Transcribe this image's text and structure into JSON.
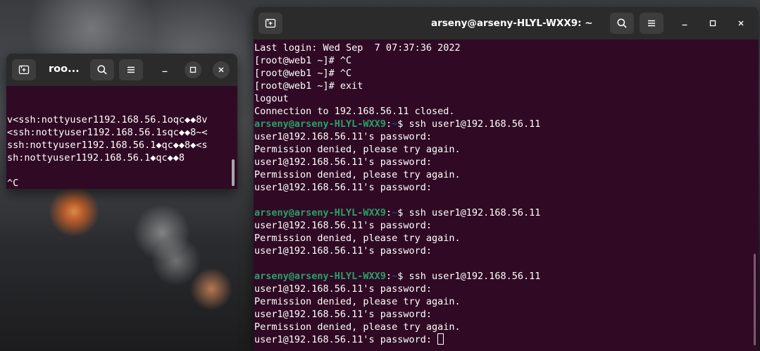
{
  "left_window": {
    "title": "roo...",
    "lines": [
      "",
      "",
      "v<ssh:nottyuser1192.168.56.1oqc◆◆8v",
      "<ssh:nottyuser1192.168.56.1sqc◆◆8~<",
      "ssh:nottyuser1192.168.56.1◆qc◆◆8◆<s",
      "sh:nottyuser1192.168.56.1◆qc◆◆8",
      "",
      "^C"
    ],
    "icons": {
      "new_tab": "new-tab-icon",
      "search": "search-icon",
      "menu": "hamburger-menu-icon",
      "minimize": "minimize-icon",
      "maximize": "maximize-icon",
      "close": "close-icon"
    }
  },
  "right_window": {
    "title": "arseny@arseny-HLYL-WXX9: ~",
    "prompt_user": "arseny@arseny-HLYL-WXX9",
    "prompt_path": "~",
    "lines": [
      {
        "text": "Last login: Wed Sep  7 07:37:36 2022"
      },
      {
        "text": "[root@web1 ~]# ^C"
      },
      {
        "text": "[root@web1 ~]# ^C"
      },
      {
        "text": "[root@web1 ~]# exit"
      },
      {
        "text": "logout"
      },
      {
        "text": "Connection to 192.168.56.11 closed."
      },
      {
        "prompt": true,
        "cmd": "$ ssh user1@192.168.56.11"
      },
      {
        "text": "user1@192.168.56.11's password:"
      },
      {
        "text": "Permission denied, please try again."
      },
      {
        "text": "user1@192.168.56.11's password:"
      },
      {
        "text": "Permission denied, please try again."
      },
      {
        "text": "user1@192.168.56.11's password:"
      },
      {
        "text": ""
      },
      {
        "prompt": true,
        "cmd": "$ ssh user1@192.168.56.11"
      },
      {
        "text": "user1@192.168.56.11's password:"
      },
      {
        "text": "Permission denied, please try again."
      },
      {
        "text": "user1@192.168.56.11's password:"
      },
      {
        "text": ""
      },
      {
        "prompt": true,
        "cmd": "$ ssh user1@192.168.56.11"
      },
      {
        "text": "user1@192.168.56.11's password:"
      },
      {
        "text": "Permission denied, please try again."
      },
      {
        "text": "user1@192.168.56.11's password:"
      },
      {
        "text": "Permission denied, please try again."
      },
      {
        "text": "user1@192.168.56.11's password: ",
        "cursor": true
      }
    ]
  },
  "colors": {
    "terminal_bg": "#300a24",
    "prompt_user": "#26a269",
    "prompt_path": "#12488b",
    "titlebar": "#2b2b2b"
  }
}
